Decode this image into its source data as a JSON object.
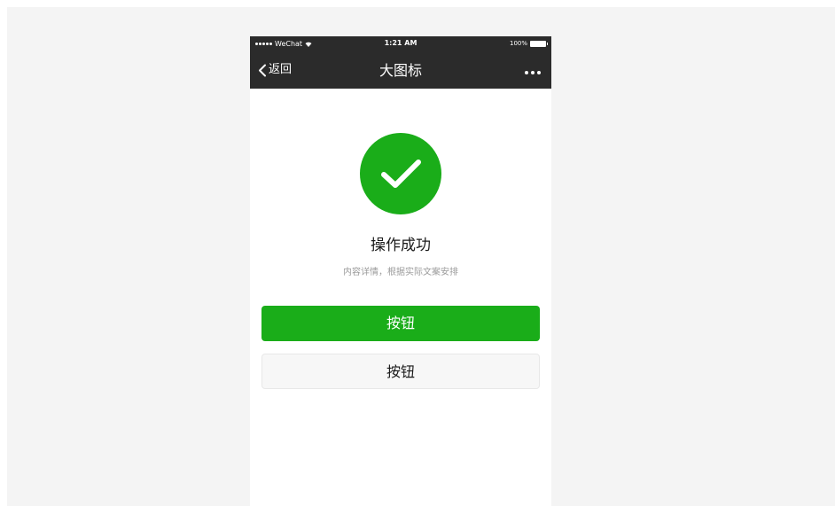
{
  "statusbar": {
    "carrier": "WeChat",
    "time": "1:21 AM",
    "battery": "100%"
  },
  "navbar": {
    "back_label": "返回",
    "title": "大图标"
  },
  "message": {
    "icon": "success-check-icon",
    "title": "操作成功",
    "description": "内容详情，根据实际文案安排"
  },
  "buttons": {
    "primary_label": "按钮",
    "default_label": "按钮"
  },
  "colors": {
    "accent": "#1aad19",
    "navbar_bg": "#2b2b2b",
    "page_bg": "#f4f4f4"
  }
}
